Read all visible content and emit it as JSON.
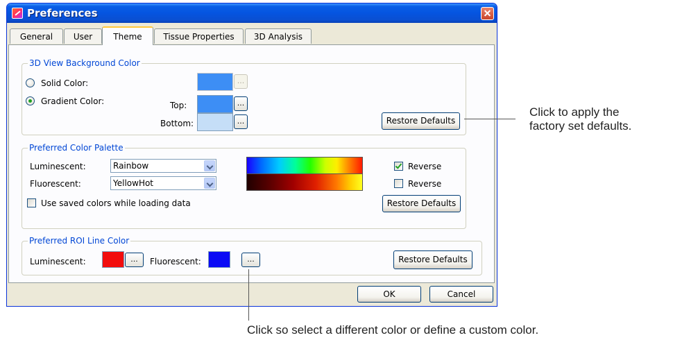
{
  "window": {
    "title": "Preferences"
  },
  "tabs": [
    {
      "label": "General"
    },
    {
      "label": "User"
    },
    {
      "label": "Theme"
    },
    {
      "label": "Tissue Properties"
    },
    {
      "label": "3D Analysis"
    }
  ],
  "background_group": {
    "legend": "3D View Background Color",
    "solid_label": "Solid Color:",
    "gradient_label": "Gradient Color:",
    "top_label": "Top:",
    "bottom_label": "Bottom:",
    "dots_label": "...",
    "restore_label": "Restore Defaults",
    "selected": "gradient",
    "colors": {
      "solid": "#3d8ef5",
      "top": "#3d8ef5",
      "bottom": "#c5def7"
    }
  },
  "palette_group": {
    "legend": "Preferred Color Palette",
    "luminescent_label": "Luminescent:",
    "luminescent_value": "Rainbow",
    "fluorescent_label": "Fluorescent:",
    "fluorescent_value": "YellowHot",
    "reverse_label_1": "Reverse",
    "reverse_checked_1": true,
    "reverse_label_2": "Reverse",
    "reverse_checked_2": false,
    "use_saved_label": "Use saved colors while loading data",
    "use_saved_checked": false,
    "restore_label": "Restore Defaults"
  },
  "roi_group": {
    "legend": "Preferred ROI Line Color",
    "luminescent_label": "Luminescent:",
    "fluorescent_label": "Fluorescent:",
    "dots_label": "...",
    "colors": {
      "luminescent": "#f20d0d",
      "fluorescent": "#0a0af5"
    },
    "restore_label": "Restore Defaults"
  },
  "footer": {
    "ok_label": "OK",
    "cancel_label": "Cancel"
  },
  "annotations": {
    "restore_note_1": "Click to apply the",
    "restore_note_2": "factory set defaults.",
    "color_note": "Click so select a different color or define a custom color."
  }
}
